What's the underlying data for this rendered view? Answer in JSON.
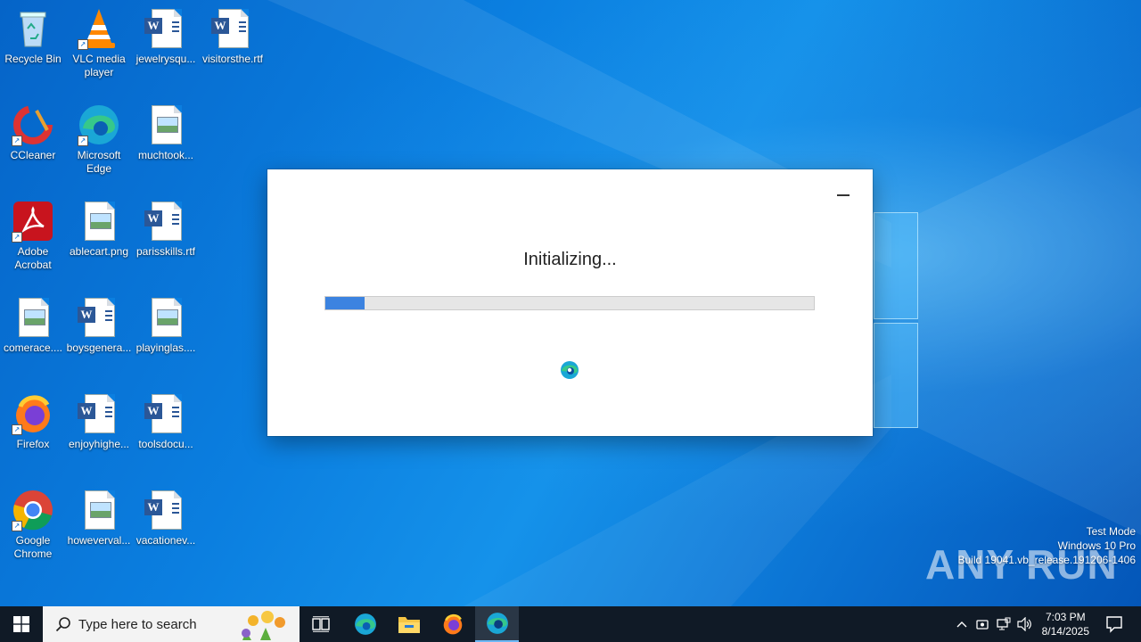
{
  "desktop": {
    "icons": [
      {
        "label": "Recycle Bin"
      },
      {
        "label": "VLC media player"
      },
      {
        "label": "jewelrysqu..."
      },
      {
        "label": "visitorsthe.rtf"
      },
      {
        "label": "CCleaner"
      },
      {
        "label": "Microsoft Edge"
      },
      {
        "label": "muchtook..."
      },
      {
        "label": "Adobe Acrobat"
      },
      {
        "label": "ablecart.png"
      },
      {
        "label": "parisskills.rtf"
      },
      {
        "label": "comerace...."
      },
      {
        "label": "boysgenera..."
      },
      {
        "label": "playinglas...."
      },
      {
        "label": "Firefox"
      },
      {
        "label": "enjoyhighe..."
      },
      {
        "label": "toolsdocu..."
      },
      {
        "label": "Google Chrome"
      },
      {
        "label": "howeverval..."
      },
      {
        "label": "vacationev..."
      }
    ]
  },
  "installer": {
    "status": "Initializing...",
    "progress_fraction": 0.08,
    "accent": "#3c83e0"
  },
  "watermark": {
    "brand": "ANY RUN",
    "line1": "Test Mode",
    "line2": "Windows 10 Pro",
    "line3": "Build 19041.vb_release.191206-1406"
  },
  "taskbar": {
    "search_placeholder": "Type here to search",
    "time": "7:03 PM",
    "date": "8/14/2025"
  }
}
